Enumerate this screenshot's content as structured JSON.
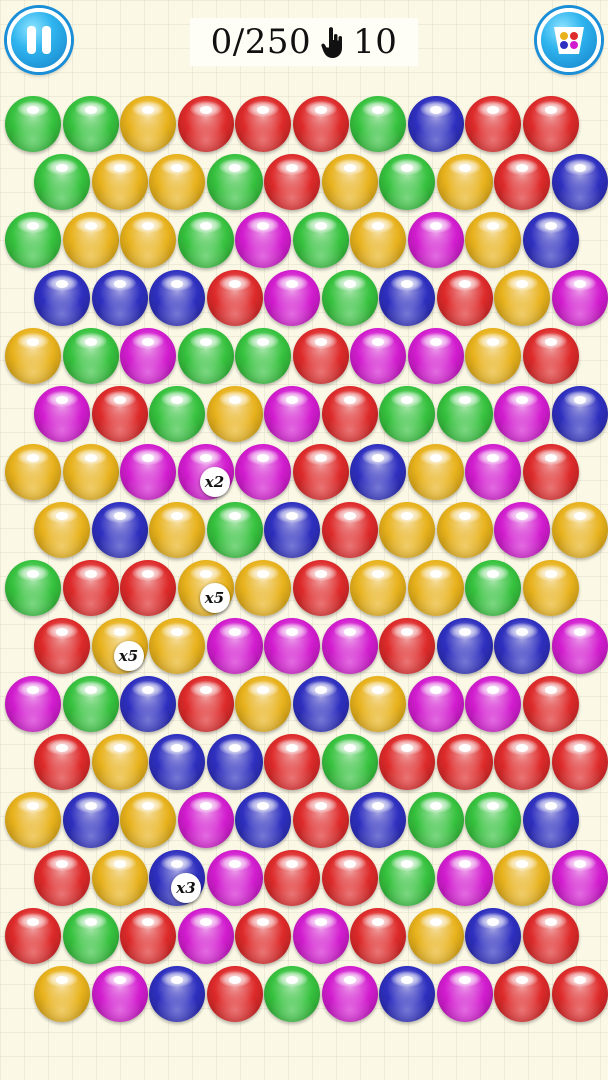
{
  "hud": {
    "score": "0/250",
    "taps_icon": "hand-tap-icon",
    "taps": "10"
  },
  "buttons": {
    "pause_icon": "pause-icon",
    "palette_icon": "palette-icon"
  },
  "colors": {
    "G": "#36c23e",
    "Y": "#e8b21c",
    "R": "#de2a2a",
    "B": "#2e2fbf",
    "M": "#d21ccf"
  },
  "board": {
    "rows": [
      "GGYRRRGBRR",
      "GYYGRYGYRB",
      "GYYGMGYMYB",
      "BBBRMGBRYM",
      "YGMGGRMMYR",
      "MRGYMRGGMB",
      "YYMMMRBYMR",
      "YBYGBRYYMY",
      "GRRYYRYYGY",
      "RYYMMMRBBM",
      "MGBRYBYMMR",
      "RYBBRGRRRR",
      "YBYMBRBGGB",
      "RYBMRRGMYM",
      "RGRMRMRYBR",
      "YMBRGMBMRR"
    ],
    "multipliers": [
      {
        "row": 6,
        "col": 3,
        "label": "x2"
      },
      {
        "row": 8,
        "col": 3,
        "label": "x5"
      },
      {
        "row": 9,
        "col": 1,
        "label": "x5"
      },
      {
        "row": 13,
        "col": 2,
        "label": "x3"
      }
    ]
  }
}
